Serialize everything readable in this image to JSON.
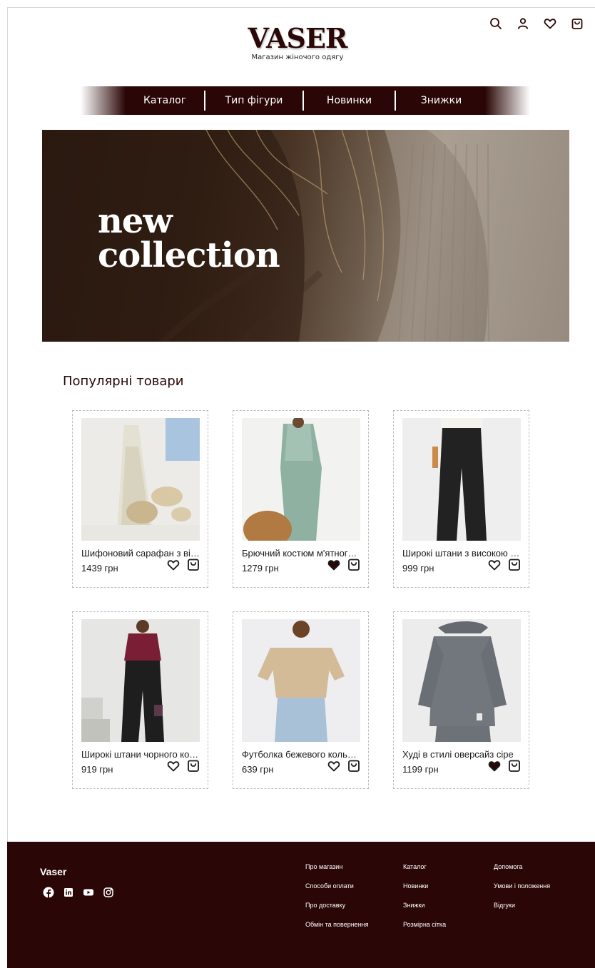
{
  "brand": {
    "title": "VASER",
    "subtitle": "Магазин жіночого одягу"
  },
  "header_icons": [
    "search-icon",
    "user-icon",
    "heart-icon",
    "bag-icon"
  ],
  "nav": {
    "items": [
      {
        "label": "Каталог"
      },
      {
        "label": "Тип фігури"
      },
      {
        "label": "Новинки"
      },
      {
        "label": "Знижки"
      }
    ]
  },
  "hero": {
    "line1": "new",
    "line2": "collection"
  },
  "popular": {
    "title": "Популярні товари",
    "products": [
      {
        "name": "Шифоновий сарафан з візерунком",
        "price": "1439 грн",
        "liked": false,
        "image": "dress-photo"
      },
      {
        "name": "Брючний костюм м'ятного кольору",
        "price": "1279 грн",
        "liked": true,
        "image": "mint-suit-photo"
      },
      {
        "name": "Широкі штани з високою талією",
        "price": "999 грн",
        "liked": false,
        "image": "black-trousers-photo"
      },
      {
        "name": "Широкі штани чорного кольору",
        "price": "919 грн",
        "liked": false,
        "image": "burgundy-blouse-photo"
      },
      {
        "name": "Футболка бежевого кольору",
        "price": "639 грн",
        "liked": false,
        "image": "beige-tshirt-photo"
      },
      {
        "name": "Худі в стилі оверсайз сіре",
        "price": "1199 грн",
        "liked": true,
        "image": "grey-hoodie-photo"
      }
    ]
  },
  "footer": {
    "brand": "Vaser",
    "social": [
      "facebook-icon",
      "linkedin-icon",
      "youtube-icon",
      "instagram-icon"
    ],
    "col1": [
      "Про магазин",
      "Способи оплати",
      "Про доставку",
      "Обмін та повернення"
    ],
    "col2": [
      "Каталог",
      "Новинки",
      "Знижки",
      "Розмірна сітка"
    ],
    "col3": [
      "Допомога",
      "Умови і положення",
      "Відгуки"
    ]
  },
  "colors": {
    "brand_dark": "#2a0706",
    "text": "#1a1a1a",
    "card_border": "#bdbdbd"
  }
}
